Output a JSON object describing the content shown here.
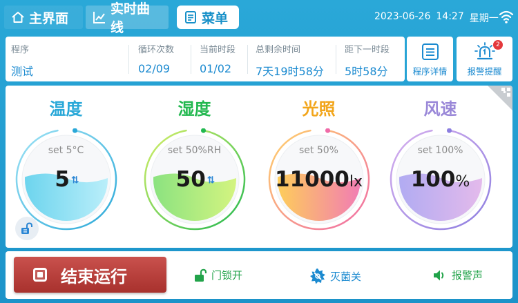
{
  "nav": {
    "home_label": "主界面",
    "curve_label": "实时曲线",
    "menu_label": "菜单"
  },
  "datetime": {
    "date": "2023-06-26",
    "time": "14:27",
    "weekday": "星期一"
  },
  "info": {
    "program": {
      "label": "程序",
      "value": "测试"
    },
    "cycles": {
      "label": "循环次数",
      "value": "02/09"
    },
    "segment": {
      "label": "当前时段",
      "value": "01/02"
    },
    "remaining": {
      "label": "总剩余时间",
      "value": "7天19时58分"
    },
    "next": {
      "label": "距下一时段",
      "value": "5时58分"
    }
  },
  "side": {
    "detail_label": "程序详情",
    "alarm_label": "报警提醒",
    "alarm_count": "2"
  },
  "gauges": [
    {
      "title": "温度",
      "set": "set 5°C",
      "value": "5",
      "unit": "",
      "arrows": "⇅",
      "color": "#29a8d8",
      "level": 0.55
    },
    {
      "title": "湿度",
      "set": "set 50%RH",
      "value": "50",
      "unit": "",
      "arrows": "⇅",
      "color": "#22b84f",
      "level": 0.55
    },
    {
      "title": "光照",
      "set": "set 50%",
      "value": "11000",
      "unit": "lx",
      "arrows": "",
      "color": "#f2a51a",
      "level": 0.55
    },
    {
      "title": "风速",
      "set": "set 100%",
      "value": "100",
      "unit": "%",
      "arrows": "",
      "color": "#9a88d8",
      "level": 0.55
    }
  ],
  "bottom": {
    "stop_label": "结束运行",
    "door_label": "门锁开",
    "sterilize_label": "灭菌关",
    "alarm_sound_label": "报警声"
  },
  "colors": {
    "brand": "#1c93c9",
    "stop": "#b83c38",
    "status_green": "#22a34a",
    "status_blue": "#1b8ad0"
  }
}
